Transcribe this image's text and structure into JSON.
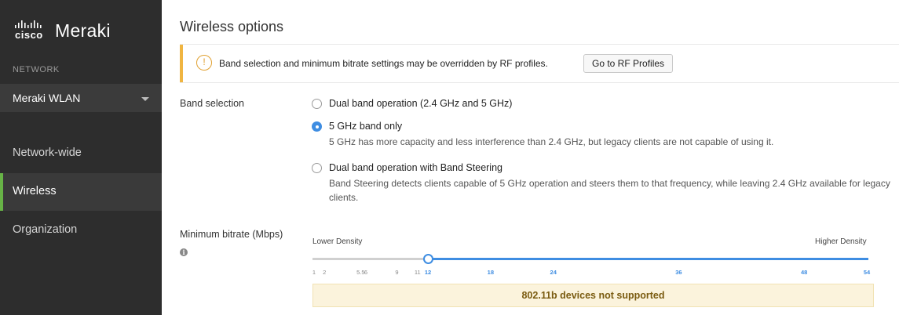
{
  "sidebar": {
    "logo_cisco": "cisco",
    "logo_meraki": "Meraki",
    "section_label": "NETWORK",
    "network_selector": "Meraki WLAN",
    "nav": [
      {
        "label": "Network-wide",
        "active": false
      },
      {
        "label": "Wireless",
        "active": true
      },
      {
        "label": "Organization",
        "active": false
      }
    ]
  },
  "main": {
    "title": "Wireless options",
    "notice": {
      "icon": "warning-circle-icon",
      "message": "Band selection and minimum bitrate settings may be overridden by RF profiles.",
      "button_label": "Go to RF Profiles"
    },
    "band_selection": {
      "label": "Band selection",
      "selected": "5ghz",
      "options": [
        {
          "id": "dual",
          "title": "Dual band operation (2.4 GHz and 5 GHz)",
          "description": ""
        },
        {
          "id": "5ghz",
          "title": "5 GHz band only",
          "description": "5 GHz has more capacity and less interference than 2.4 GHz, but legacy clients are not capable of using it."
        },
        {
          "id": "steering",
          "title": "Dual band operation with Band Steering",
          "description": "Band Steering detects clients capable of 5 GHz operation and steers them to that frequency, while leaving 2.4 GHz available for legacy clients."
        }
      ]
    },
    "min_bitrate": {
      "label": "Minimum bitrate (Mbps)",
      "info_icon": "info-icon",
      "lower_label": "Lower Density",
      "higher_label": "Higher Density",
      "value": 12,
      "ticks": [
        "1",
        "2",
        "5.5",
        "6",
        "9",
        "11",
        "12",
        "18",
        "24",
        "36",
        "48",
        "54"
      ],
      "note": "802.11b devices not supported"
    }
  },
  "colors": {
    "sidebar_bg": "#2d2d2d",
    "active_accent": "#67b346",
    "primary_blue": "#3e8de2",
    "warning_stripe": "#f0b541",
    "note_bg": "#fbf3dc"
  }
}
